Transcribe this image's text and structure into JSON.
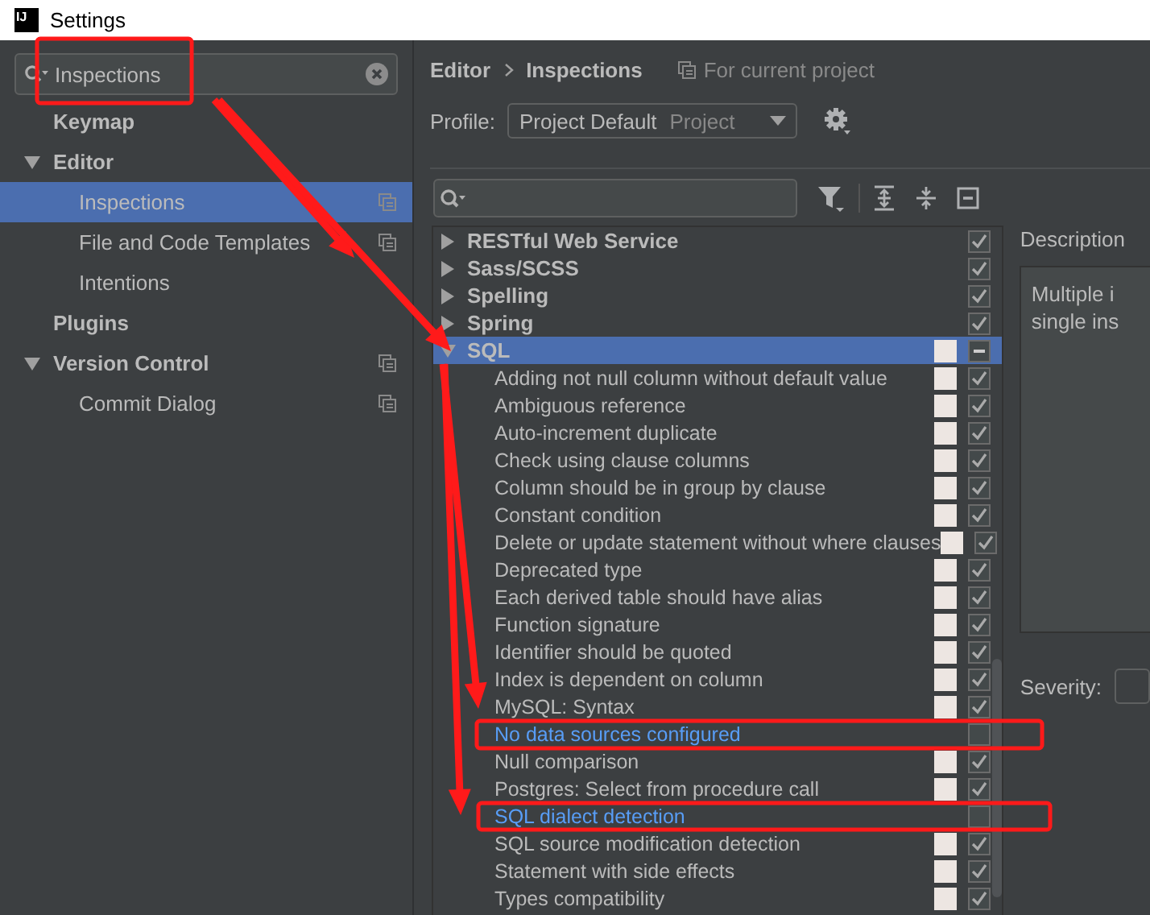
{
  "window": {
    "logo_text": "IJ",
    "title": "Settings"
  },
  "sidebar": {
    "search": {
      "value": "Inspections"
    },
    "items": [
      {
        "label": "Keymap",
        "project_icon": false
      },
      {
        "label": "Editor",
        "expanded": true,
        "project_icon": false,
        "children": [
          {
            "label": "Inspections",
            "selected": true,
            "project_icon": true
          },
          {
            "label": "File and Code Templates",
            "selected": false,
            "project_icon": true
          },
          {
            "label": "Intentions",
            "selected": false,
            "project_icon": false
          }
        ]
      },
      {
        "label": "Plugins",
        "project_icon": false
      },
      {
        "label": "Version Control",
        "expanded": true,
        "project_icon": true,
        "children": [
          {
            "label": "Commit Dialog",
            "selected": false,
            "project_icon": true
          }
        ]
      }
    ]
  },
  "breadcrumb": [
    "Editor",
    "Inspections"
  ],
  "scope_note": "For current project",
  "profile": {
    "label": "Profile:",
    "value": "Project Default",
    "hint": "Project"
  },
  "tree": [
    {
      "label": "RESTful Web Service",
      "expanded": false,
      "selected": false,
      "checked": true,
      "swatch": false
    },
    {
      "label": "Sass/SCSS",
      "expanded": false,
      "selected": false,
      "checked": true,
      "swatch": false
    },
    {
      "label": "Spelling",
      "expanded": false,
      "selected": false,
      "checked": true,
      "swatch": false
    },
    {
      "label": "Spring",
      "expanded": false,
      "selected": false,
      "checked": true,
      "swatch": false
    },
    {
      "label": "SQL",
      "expanded": true,
      "selected": true,
      "indeterminate": true,
      "swatch": true,
      "children": [
        {
          "label": "Adding not null column without default value",
          "checked": true,
          "modified": false,
          "swatch": true
        },
        {
          "label": "Ambiguous reference",
          "checked": true,
          "modified": false,
          "swatch": true
        },
        {
          "label": "Auto-increment duplicate",
          "checked": true,
          "modified": false,
          "swatch": true
        },
        {
          "label": "Check using clause columns",
          "checked": true,
          "modified": false,
          "swatch": true
        },
        {
          "label": "Column should be in group by clause",
          "checked": true,
          "modified": false,
          "swatch": true
        },
        {
          "label": "Constant condition",
          "checked": true,
          "modified": false,
          "swatch": true
        },
        {
          "label": "Delete or update statement without where clauses",
          "checked": true,
          "modified": false,
          "swatch": true
        },
        {
          "label": "Deprecated type",
          "checked": true,
          "modified": false,
          "swatch": true
        },
        {
          "label": "Each derived table should have alias",
          "checked": true,
          "modified": false,
          "swatch": true
        },
        {
          "label": "Function signature",
          "checked": true,
          "modified": false,
          "swatch": true
        },
        {
          "label": "Identifier should be quoted",
          "checked": true,
          "modified": false,
          "swatch": true
        },
        {
          "label": "Index is dependent on column",
          "checked": true,
          "modified": false,
          "swatch": true
        },
        {
          "label": "MySQL: Syntax",
          "checked": true,
          "modified": false,
          "swatch": true
        },
        {
          "label": "No data sources configured",
          "checked": false,
          "modified": true,
          "swatch": false
        },
        {
          "label": "Null comparison",
          "checked": true,
          "modified": false,
          "swatch": true
        },
        {
          "label": "Postgres: Select from procedure call",
          "checked": true,
          "modified": false,
          "swatch": true
        },
        {
          "label": "SQL dialect detection",
          "checked": false,
          "modified": true,
          "swatch": false
        },
        {
          "label": "SQL source modification detection",
          "checked": true,
          "modified": false,
          "swatch": true
        },
        {
          "label": "Statement with side effects",
          "checked": true,
          "modified": false,
          "swatch": true
        },
        {
          "label": "Types compatibility",
          "checked": true,
          "modified": false,
          "swatch": true
        }
      ]
    }
  ],
  "description": {
    "label": "Description",
    "lines": [
      "Multiple i",
      "single ins"
    ]
  },
  "severity": {
    "label": "Severity:"
  }
}
